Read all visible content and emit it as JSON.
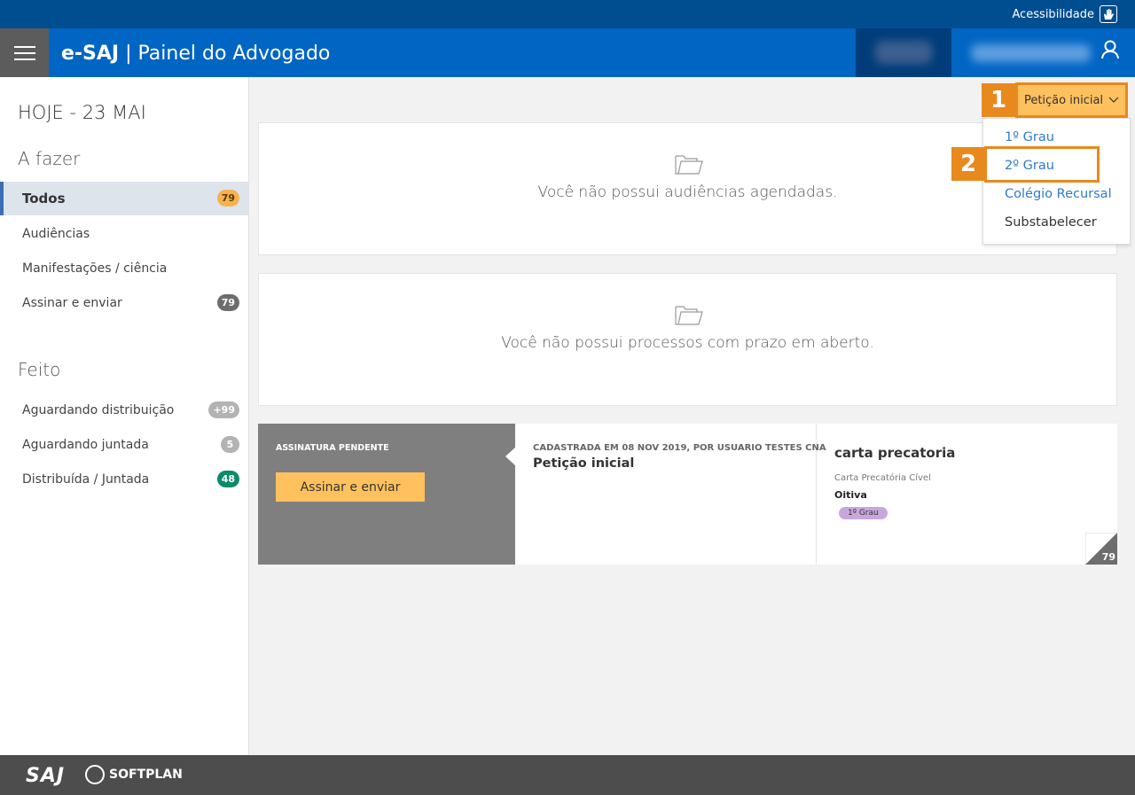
{
  "topbar": {
    "accessibility_label": "Acessibilidade"
  },
  "header": {
    "app_name": "e-SAJ",
    "separator": "|",
    "page_title": "Painel do Advogado"
  },
  "sidebar": {
    "today": "HOJE - 23 MAI",
    "todo_title": "A fazer",
    "todo_items": [
      {
        "label": "Todos",
        "badge": "79"
      },
      {
        "label": "Audiências",
        "badge": ""
      },
      {
        "label": "Manifestações / ciência",
        "badge": ""
      },
      {
        "label": "Assinar e enviar",
        "badge": "79"
      }
    ],
    "done_title": "Feito",
    "done_items": [
      {
        "label": "Aguardando distribuição",
        "badge": "+99"
      },
      {
        "label": "Aguardando juntada",
        "badge": "5"
      },
      {
        "label": "Distribuída / Juntada",
        "badge": "48"
      }
    ]
  },
  "main": {
    "empty_hearings": "Você não possui audiências agendadas.",
    "empty_deadlines": "Você não possui processos com prazo em aberto."
  },
  "task": {
    "status": "ASSINATURA PENDENTE",
    "action_label": "Assinar e enviar",
    "registered": "CADASTRADA EM 08 NOV 2019, POR USUARIO TESTES CNA",
    "kind": "Petição inicial",
    "title": "carta precatoria",
    "class": "Carta Precatória Cível",
    "subject": "Oitiva",
    "tag": "1º Grau",
    "count": "79"
  },
  "dropdown": {
    "selected": "Petição inicial",
    "options": [
      "1º Grau",
      "2º Grau",
      "Colégio Recursal",
      "Substabelecer"
    ]
  },
  "annotations": {
    "step1": "1",
    "step2": "2"
  },
  "footer": {
    "saj": "SAJ",
    "softplan": "SOFTPLAN"
  },
  "colors": {
    "topbar": "#004e8f",
    "header": "#0065c3",
    "accent": "#e8891e",
    "button": "#ffc15e",
    "link": "#2e7bcf"
  }
}
